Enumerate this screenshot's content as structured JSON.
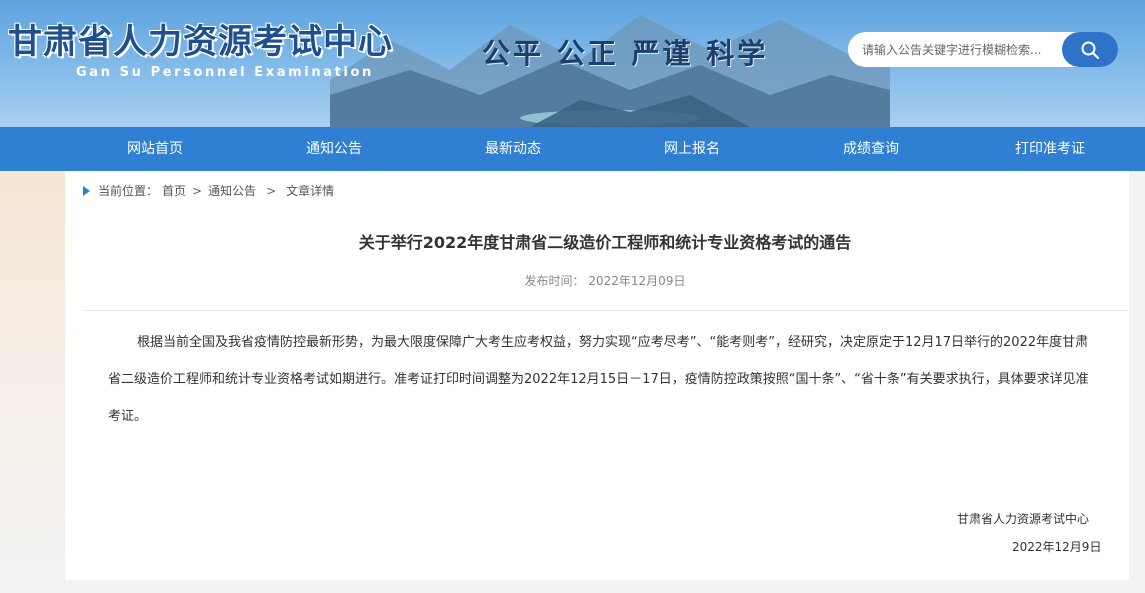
{
  "header": {
    "title": "甘肃省人力资源考试中心",
    "subtitle": "Gan Su Personnel Examination",
    "slogan": "公平 公正 严谨 科学",
    "search": {
      "placeholder": "请输入公告关键字进行模糊检索...",
      "value": "",
      "button_icon": "search-icon"
    },
    "colors": {
      "banner_blue": "#5ea3df",
      "title_blue": "#1f4f8c",
      "nav_blue": "#2f7fd2",
      "search_button": "#2f73c7"
    }
  },
  "nav": {
    "items": [
      {
        "label": "网站首页"
      },
      {
        "label": "通知公告"
      },
      {
        "label": "最新动态"
      },
      {
        "label": "网上报名"
      },
      {
        "label": "成绩查询"
      },
      {
        "label": "打印准考证"
      }
    ]
  },
  "breadcrumb": {
    "prefix": "当前位置：",
    "items": [
      "首页",
      "通知公告",
      "文章详情"
    ],
    "separator": ">"
  },
  "article": {
    "title": "关于举行2022年度甘肃省二级造价工程师和统计专业资格考试的通告",
    "publish_label": "发布时间：",
    "publish_date": "2022年12月09日",
    "body": "根据当前全国及我省疫情防控最新形势，为最大限度保障广大考生应考权益，努力实现“应考尽考”、“能考则考”，经研究，决定原定于12月17日举行的2022年度甘肃省二级造价工程师和统计专业资格考试如期进行。准考证打印时间调整为2022年12月15日－17日，疫情防控政策按照“国十条”、“省十条”有关要求执行，具体要求详见准考证。",
    "signature_org": "甘肃省人力资源考试中心",
    "signature_date": "2022年12月9日"
  }
}
